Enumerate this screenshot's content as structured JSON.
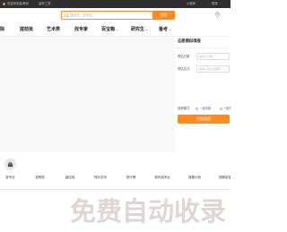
{
  "colors": {
    "accent": "#ff8a1f",
    "topbar": "#2e2e2e"
  },
  "topbar": {
    "logo_icon": "dot-icon",
    "welcome": "欢迎来到高考网",
    "tools_link": "高考工具",
    "right_links": [
      "小程序",
      "登录"
    ]
  },
  "header": {
    "search": {
      "icon": "search-icon",
      "placeholder": "搜大学、找专业",
      "value": "",
      "button_label": "搜索"
    },
    "location_icon": "location-pin-icon"
  },
  "nav": {
    "items": [
      {
        "label": "院"
      },
      {
        "label": "提前批"
      },
      {
        "label": "艺术类"
      },
      {
        "label": "找专家"
      },
      {
        "label": "百宝箱",
        "icon": "chevron-down-icon"
      },
      {
        "label": "研究生",
        "icon": "chevron-down-icon"
      },
      {
        "label": "备考",
        "icon": "chevron-down-icon"
      }
    ]
  },
  "simulator": {
    "title": "志愿模拟填报",
    "fields": [
      {
        "label": "预估分数",
        "placeholder": "请输入分数",
        "value": ""
      },
      {
        "label": "预估位次",
        "placeholder": "请输入位次(选填)",
        "value": ""
      }
    ],
    "mode": {
      "label": "填报模式",
      "options": [
        "一键冲稳",
        "一键保底"
      ]
    },
    "submit_label": "智能填报"
  },
  "tools": {
    "items": [
      {
        "label": "查专业",
        "icon": "briefcase-icon"
      },
      {
        "label": "查院校"
      },
      {
        "label": "省控线"
      },
      {
        "label": "同分去向"
      },
      {
        "label": "排行榜"
      },
      {
        "label": "测评选专业"
      },
      {
        "label": "强基计划"
      },
      {
        "label": "视频讲堂"
      }
    ]
  },
  "watermark": "免费自动收录"
}
